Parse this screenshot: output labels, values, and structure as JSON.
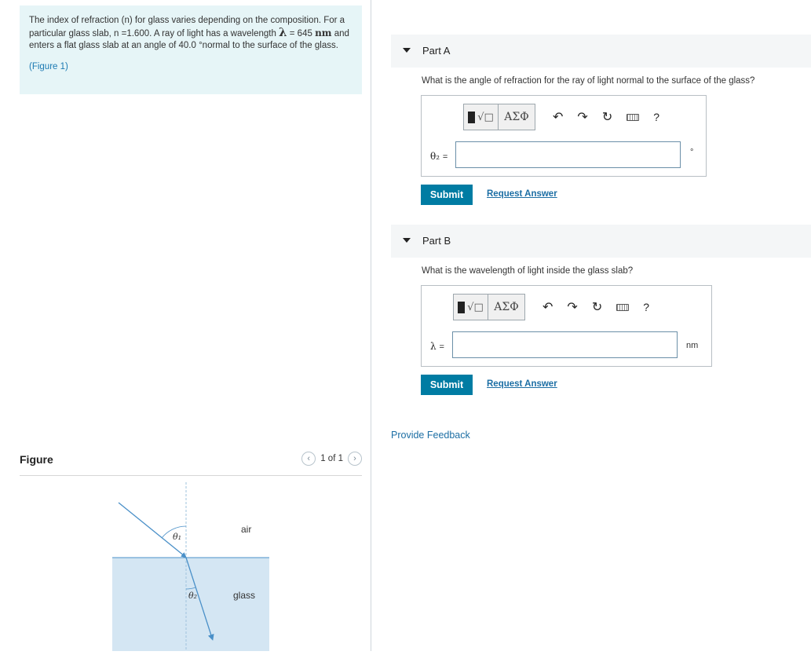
{
  "problem": {
    "text_part1": "The index of refraction (n) for glass varies depending on the composition. For a particular glass slab, n =1.600. A ray of light has a wavelength ",
    "lambda_symbol": "λ",
    "text_part2": " = 645 ",
    "unit_nm": "nm",
    "text_part3": " and enters a flat glass slab at an angle of 40.0 °normal to the surface of the glass.",
    "figure_link": "(Figure 1)"
  },
  "figure": {
    "title": "Figure",
    "pager_text": "1 of 1",
    "prev_icon": "chevron-left-icon",
    "next_icon": "chevron-right-icon",
    "label_air": "air",
    "label_glass": "glass",
    "label_theta1": "θ₁",
    "label_theta2": "θ₂",
    "colors": {
      "glass_fill": "#d4e6f3",
      "ray": "#4a90c8",
      "normal": "#9fc3dc"
    }
  },
  "part_a": {
    "label": "Part A",
    "question": "What is the angle of refraction for the ray of light normal to the surface of the glass?",
    "variable": "θ₂",
    "equals": "=",
    "unit": "°",
    "input_value": "",
    "submit": "Submit",
    "request_answer": "Request Answer"
  },
  "part_b": {
    "label": "Part B",
    "question": "What is the wavelength of light inside the glass slab?",
    "variable": "λ",
    "equals": "=",
    "unit": "nm",
    "input_value": "",
    "submit": "Submit",
    "request_answer": "Request Answer"
  },
  "toolbar": {
    "templates_icon": "sqrt-template-icon",
    "templates_symbol": "√□",
    "greek_label": "ΑΣΦ",
    "undo_icon": "undo-icon",
    "redo_icon": "redo-icon",
    "reset_icon": "reset-icon",
    "keyboard_icon": "keyboard-icon",
    "help_label": "?"
  },
  "feedback": "Provide Feedback"
}
